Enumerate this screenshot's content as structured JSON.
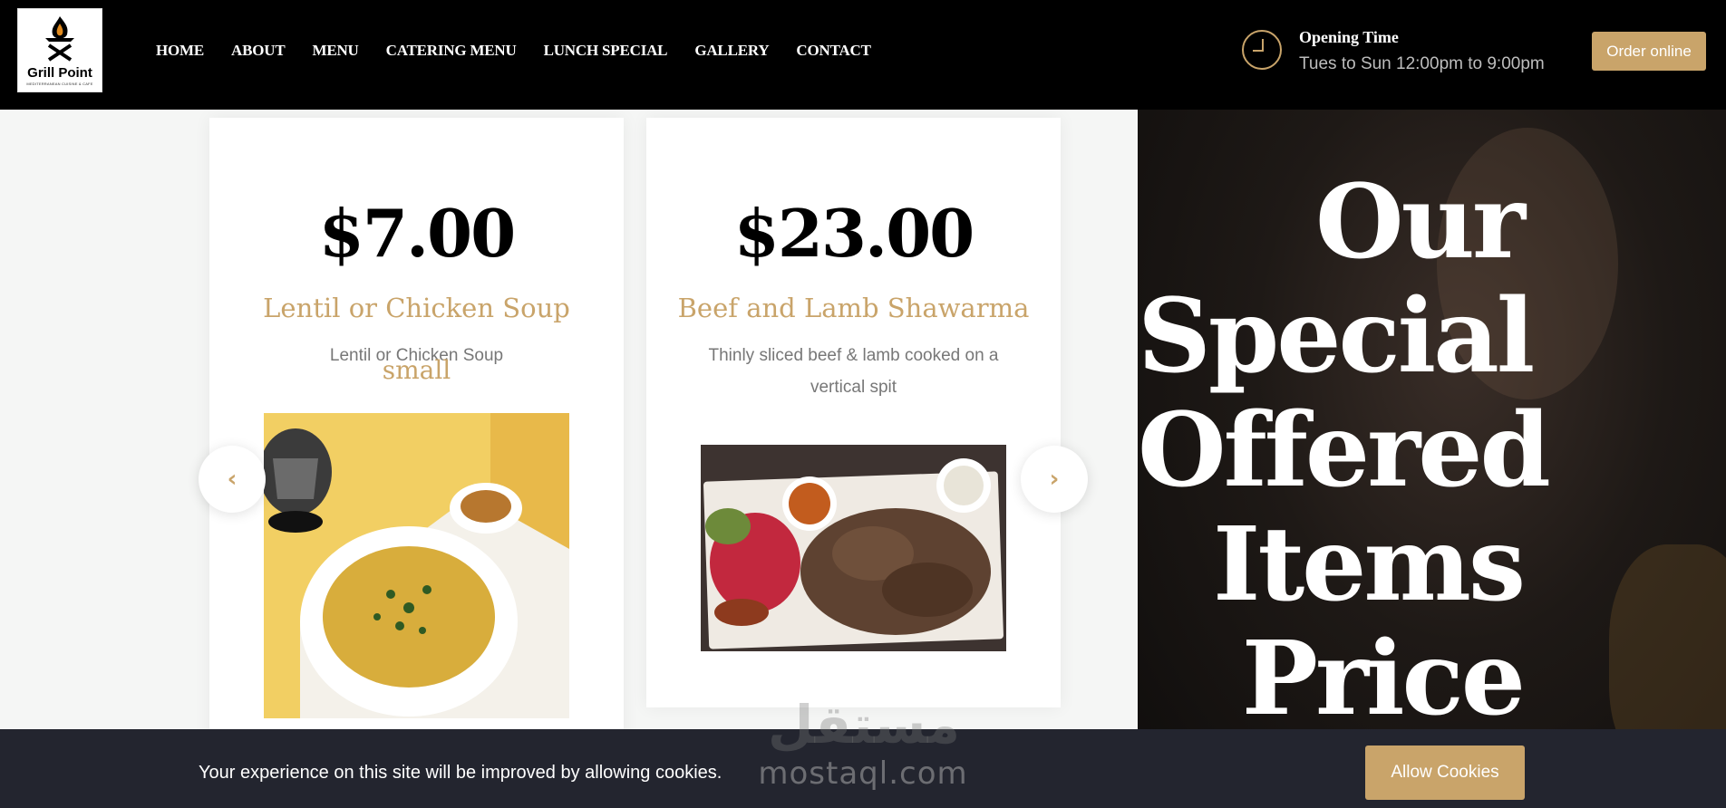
{
  "header": {
    "logo": {
      "brand": "Grill Point",
      "tagline": "MEDITERRANEAN CUISINE & CAFE"
    },
    "nav": [
      "HOME",
      "ABOUT",
      "MENU",
      "CATERING MENU",
      "LUNCH SPECIAL",
      "GALLERY",
      "CONTACT"
    ],
    "opening": {
      "title": "Opening Time",
      "hours": "Tues to Sun 12:00pm to 9:00pm"
    },
    "order_button": "Order online"
  },
  "carousel": {
    "items": [
      {
        "price": "$7.00",
        "name": "Lentil or Chicken Soup",
        "description": "Lentil or Chicken Soup",
        "size": "small",
        "image": "lentil-soup-photo"
      },
      {
        "price": "$23.00",
        "name": "Beef and Lamb Shawarma",
        "description": "Thinly sliced beef & lamb cooked on a vertical spit",
        "image": "shawarma-plate-photo"
      }
    ],
    "prev_icon": "chevron-left-icon",
    "next_icon": "chevron-right-icon"
  },
  "special": {
    "lines": [
      "Our",
      "Special",
      "Offered",
      "Items",
      "Price"
    ]
  },
  "cookie": {
    "text": "Your experience on this site will be improved by allowing cookies.",
    "button": "Allow Cookies"
  },
  "watermark": {
    "arabic": "مستقل",
    "latin": "mostaql.com"
  },
  "colors": {
    "accent": "#c9a46a",
    "header_bg": "#000000",
    "cookie_bg": "#23252f"
  }
}
